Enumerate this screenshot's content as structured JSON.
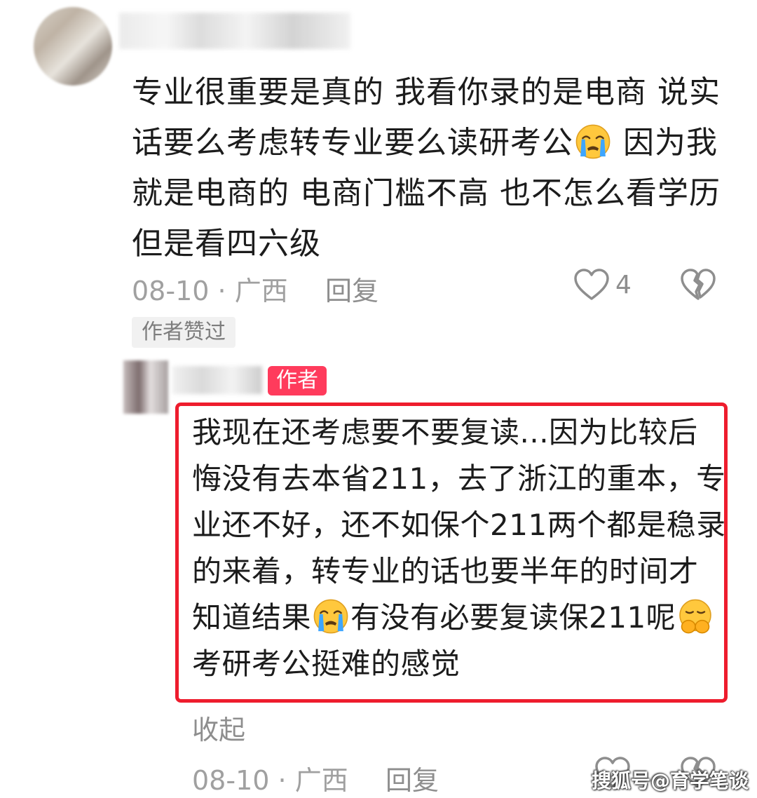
{
  "comment": {
    "text_parts": [
      "专业很重要是真的 我看你录的是电商 说实话要么考虑转专业要么读研考公",
      " 因为我就是电商的 电商门槛不高 也不怎么看学历 但是看四六级"
    ],
    "date": "08-10",
    "separator": "·",
    "region": "广西",
    "reply_label": "回复",
    "likes": "4",
    "author_liked_label": "作者赞过",
    "emoji": "loudly-crying-face-icon"
  },
  "reply": {
    "author_badge": "作者",
    "text_parts": [
      "我现在还考虑要不要复读...因为比较后悔没有去本省211，去了浙江的重本，专业还不好，还不如保个211两个都是稳录的来着，转专业的话也要半年的时间才知道结果",
      "有没有必要复读保211呢",
      "考研考公挺难的感觉"
    ],
    "collapse_label": "收起",
    "date": "08-10",
    "separator": "·",
    "region": "广西",
    "reply_label": "回复",
    "emojis": [
      "loudly-crying-face-icon",
      "pleading-hands-face-icon"
    ]
  },
  "watermark": "搜狐号@育学笔谈",
  "colors": {
    "badge": "#ff3b5c",
    "highlight_border": "#ee1c2d",
    "meta_text": "#a0a0a0"
  }
}
